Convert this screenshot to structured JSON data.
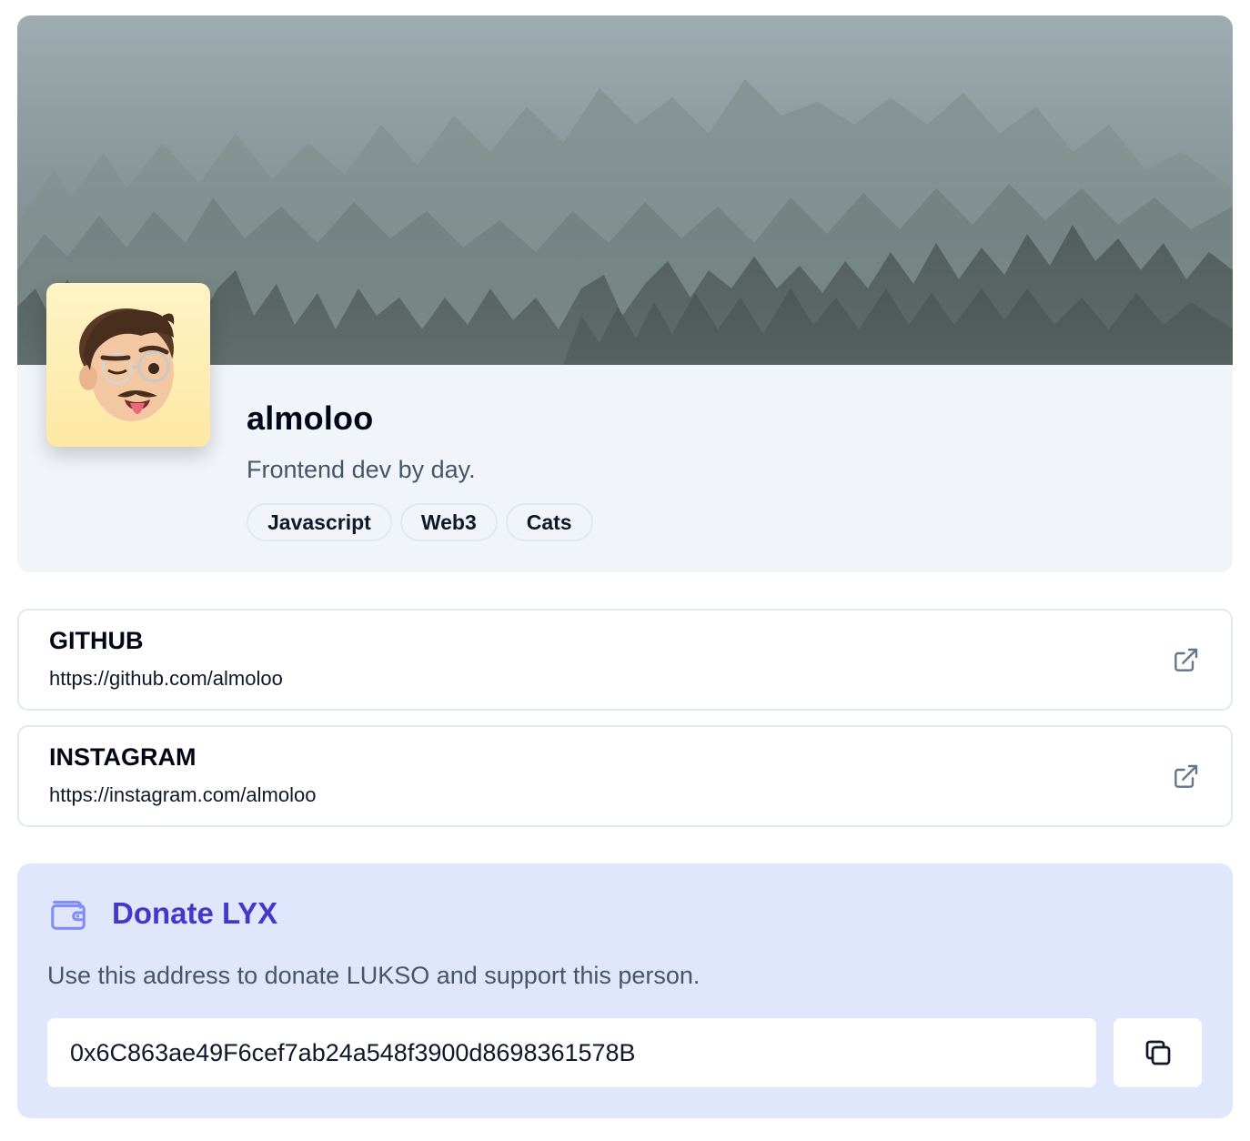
{
  "profile": {
    "username": "almoloo",
    "bio": "Frontend dev by day.",
    "tags": [
      "Javascript",
      "Web3",
      "Cats"
    ]
  },
  "links": [
    {
      "title": "GITHUB",
      "url": "https://github.com/almoloo"
    },
    {
      "title": "INSTAGRAM",
      "url": "https://instagram.com/almoloo"
    }
  ],
  "donate": {
    "title": "Donate LYX",
    "description": "Use this address to donate LUKSO and support this person.",
    "address": "0x6C863ae49F6cef7ab24a548f3900d8698361578B"
  },
  "icons": {
    "external_link": "external-link-icon",
    "wallet": "wallet-icon",
    "copy": "copy-icon"
  },
  "colors": {
    "accent": "#4338ca",
    "donate_bg": "#e0e7fd",
    "card_bg": "#f1f5f9"
  }
}
